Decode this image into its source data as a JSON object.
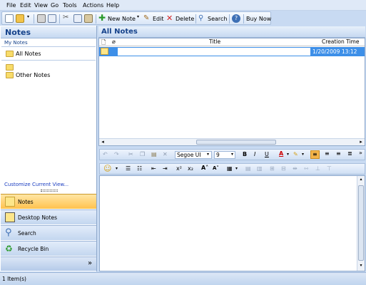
{
  "menu": [
    "File",
    "Edit",
    "View",
    "Go",
    "Tools",
    "Actions",
    "Help"
  ],
  "toolbar": {
    "new_note": "New Note",
    "edit": "Edit",
    "delete": "Delete",
    "search": "Search",
    "buy_now": "Buy Now"
  },
  "left": {
    "title": "Notes",
    "section": "My Notes",
    "all_notes": "All Notes",
    "folder_empty": "",
    "other_notes": "Other Notes",
    "customize": "Customize Current View...",
    "nav": [
      "Notes",
      "Desktop Notes",
      "Search",
      "Recycle Bin"
    ],
    "footer_chevron": "»"
  },
  "right": {
    "title": "All Notes",
    "columns": [
      "Title",
      "Creation Time"
    ],
    "rows": [
      {
        "title": "",
        "created": "1/20/2009 13:12"
      }
    ]
  },
  "format": {
    "font": "Segoe UI",
    "size": "9",
    "bold": "B",
    "italic": "I",
    "underline": "U",
    "font_color": "A",
    "superscript": "x²",
    "subscript": "x₂",
    "grow": "A˄",
    "shrink": "A˅"
  },
  "status": "1 Item(s)",
  "colors": {
    "accent": "#15428b",
    "selection": "#3d8fe8",
    "active_nav": "#ffc24e"
  }
}
